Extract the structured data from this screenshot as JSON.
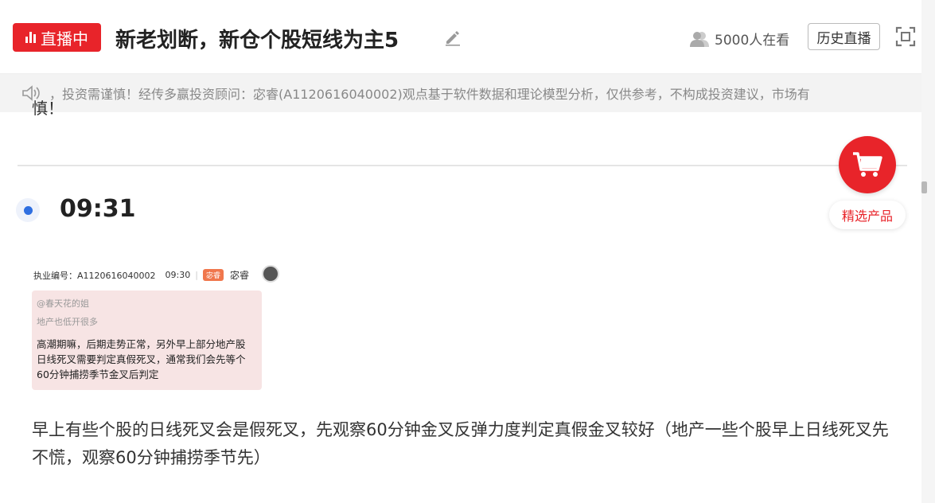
{
  "header": {
    "live_label": "直播中",
    "title": "新老划断，新仓个股短线为主5",
    "viewers": "5000人在看",
    "history_label": "历史直播"
  },
  "notice": {
    "text": "，投资需谨慎！经传多赢投资顾问：宓睿(A1120616040002)观点基于软件数据和理论模型分析，仅供参考，不构成投资建议，市场有"
  },
  "feed": {
    "cut_text": "慎！",
    "entry": {
      "time": "09:31",
      "embed": {
        "license": "执业编号：A1120616040002",
        "time": "09:30",
        "tag": "宓睿",
        "author": "宓睿",
        "quote_user": "@春天花的姐",
        "quote_text": "地产也低开很多",
        "answer": "高潮期嘛，后期走势正常，另外早上部分地产股日线死叉需要判定真假死叉，通常我们会先等个60分钟捕捞季节金叉后判定"
      },
      "text": "早上有些个股的日线死叉会是假死叉，先观察60分钟金叉反弹力度判定真假金叉较好（地产一些个股早上日线死叉先不慌，观察60分钟捕捞季节先）"
    }
  },
  "cart": {
    "label": "精选产品"
  },
  "colors": {
    "accent": "#e8242a",
    "dot": "#2f6fe0"
  }
}
